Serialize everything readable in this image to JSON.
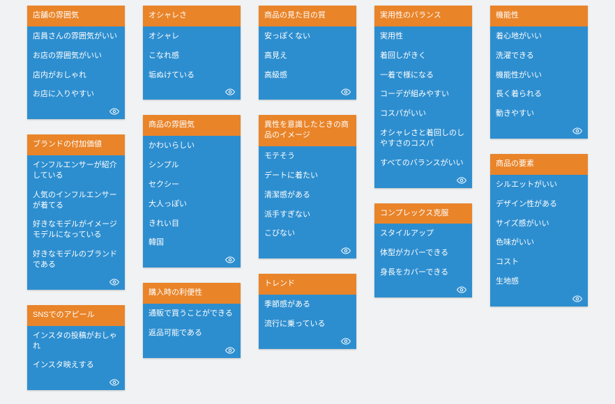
{
  "columns": [
    {
      "cards": [
        {
          "title": "店舗の雰囲気",
          "items": [
            "店員さんの雰囲気がいい",
            "お店の雰囲気がいい",
            "店内がおしゃれ",
            "お店に入りやすい"
          ]
        },
        {
          "title": "ブランドの付加価値",
          "items": [
            "インフルエンサーが紹介している",
            "人気のインフルエンサーが着てる",
            "好きなモデルがイメージモデルになっている",
            "好きなモデルのブランドである"
          ]
        },
        {
          "title": "SNSでのアピール",
          "items": [
            "インスタの投稿がおしゃれ",
            "インスタ映えする"
          ]
        }
      ]
    },
    {
      "cards": [
        {
          "title": "オシャレさ",
          "items": [
            "オシャレ",
            "こなれ感",
            "垢ぬけている"
          ]
        },
        {
          "title": "商品の雰囲気",
          "items": [
            "かわいらしい",
            "シンプル",
            "セクシー",
            "大人っぽい",
            "きれい目",
            "韓国"
          ]
        },
        {
          "title": "購入時の利便性",
          "items": [
            "通販で買うことができる",
            "返品可能である"
          ]
        }
      ]
    },
    {
      "cards": [
        {
          "title": "商品の見た目の質",
          "items": [
            "安っぽくない",
            "高見え",
            "高級感"
          ]
        },
        {
          "title": "異性を意識したときの商品のイメージ",
          "items": [
            "モテそう",
            "デートに着たい",
            "清潔感がある",
            "派手すぎない",
            "こびない"
          ]
        },
        {
          "title": "トレンド",
          "items": [
            "季節感がある",
            "流行に乗っている"
          ]
        }
      ]
    },
    {
      "cards": [
        {
          "title": "実用性のバランス",
          "items": [
            "実用性",
            "着回しがきく",
            "一着で様になる",
            "コーデが組みやすい",
            "コスパがいい",
            "オシャレさと着回しのしやすさのコスパ",
            "すべてのバランスがいい"
          ]
        },
        {
          "title": "コンプレックス克服",
          "items": [
            "スタイルアップ",
            "体型がカバーできる",
            "身長をカバーできる"
          ]
        }
      ]
    },
    {
      "cards": [
        {
          "title": "機能性",
          "items": [
            "着心地がいい",
            "洗濯できる",
            "機能性がいい",
            "長く着られる",
            "動きやすい"
          ]
        },
        {
          "title": "商品の要素",
          "items": [
            "シルエットがいい",
            "デザイン性がある",
            "サイズ感がいい",
            "色味がいい",
            "コスト",
            "生地感"
          ]
        }
      ]
    }
  ]
}
